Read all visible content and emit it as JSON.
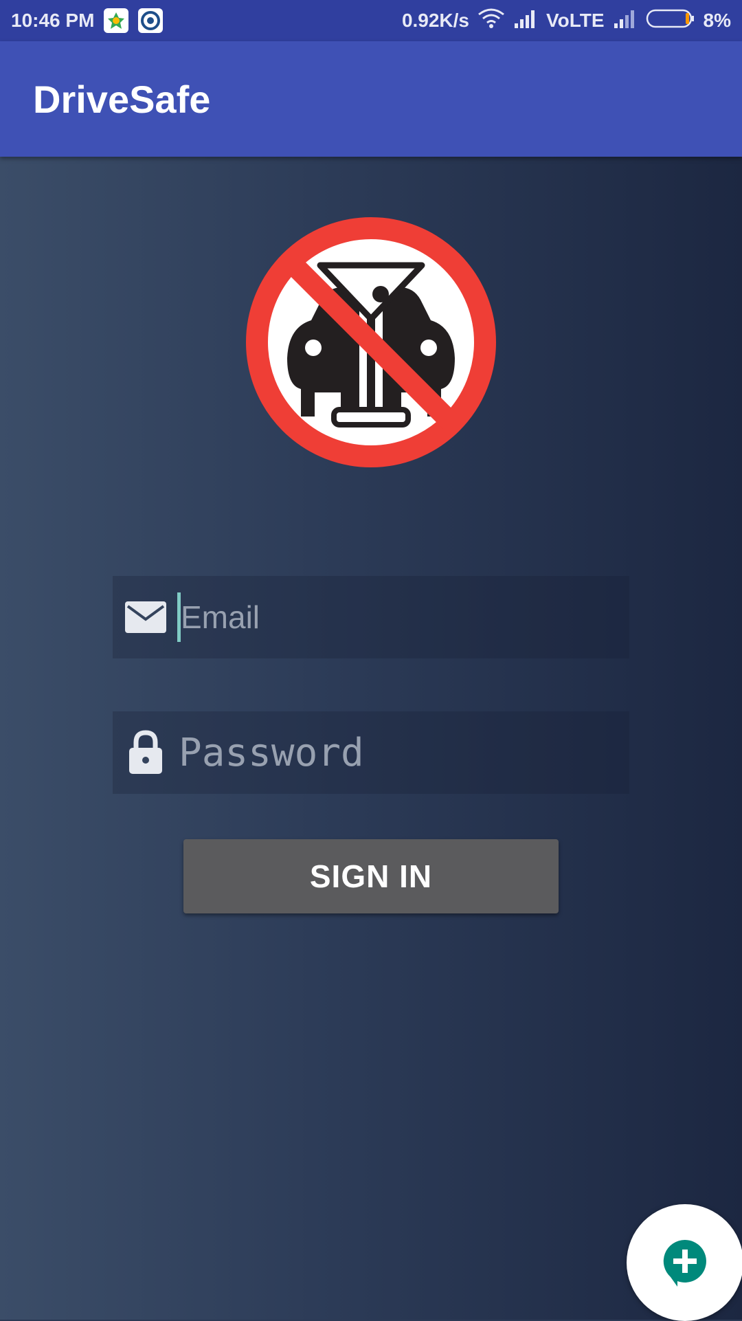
{
  "status_bar": {
    "time": "10:46 PM",
    "speed": "0.92K/s",
    "network": "VoLTE",
    "battery": "8%",
    "icons": [
      "play-games-icon",
      "camera-app-icon",
      "wifi-icon",
      "signal-icon",
      "signal-icon",
      "battery-icon"
    ]
  },
  "app_bar": {
    "title": "DriveSafe"
  },
  "logo": {
    "icon": "no-drink-driving-sign-icon",
    "colors": {
      "ring": "#ef3e36",
      "figure": "#231f20"
    }
  },
  "form": {
    "email": {
      "placeholder": "Email",
      "value": "",
      "icon": "mail-icon"
    },
    "password": {
      "placeholder": "Password",
      "value": "",
      "icon": "lock-icon"
    },
    "sign_in_label": "SIGN IN"
  },
  "fab": {
    "icon": "add-chat-icon",
    "color": "#00897b"
  },
  "colors": {
    "app_bar": "#3f51b5",
    "status_bar": "#303f9f",
    "button": "#5b5b5d",
    "cursor": "#80cbc4"
  }
}
